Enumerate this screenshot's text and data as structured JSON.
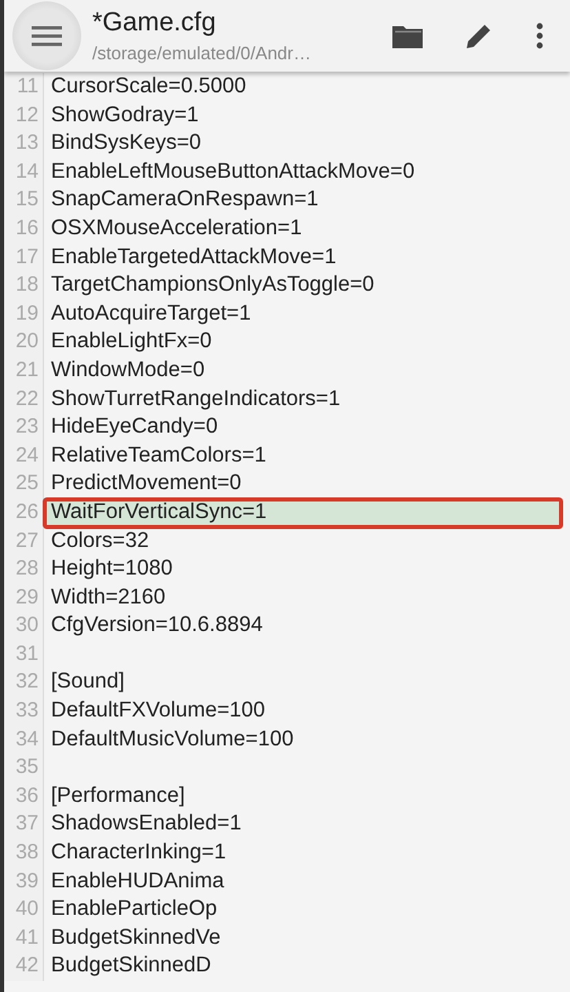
{
  "toolbar": {
    "title": "*Game.cfg",
    "path": "/storage/emulated/0/Andr…"
  },
  "lines": [
    {
      "number": "11",
      "text": "CursorScale=0.5000",
      "highlighted": false
    },
    {
      "number": "12",
      "text": "ShowGodray=1",
      "highlighted": false
    },
    {
      "number": "13",
      "text": "BindSysKeys=0",
      "highlighted": false
    },
    {
      "number": "14",
      "text": "EnableLeftMouseButtonAttackMove=0",
      "highlighted": false
    },
    {
      "number": "15",
      "text": "SnapCameraOnRespawn=1",
      "highlighted": false
    },
    {
      "number": "16",
      "text": "OSXMouseAcceleration=1",
      "highlighted": false
    },
    {
      "number": "17",
      "text": "EnableTargetedAttackMove=1",
      "highlighted": false
    },
    {
      "number": "18",
      "text": "TargetChampionsOnlyAsToggle=0",
      "highlighted": false
    },
    {
      "number": "19",
      "text": "AutoAcquireTarget=1",
      "highlighted": false
    },
    {
      "number": "20",
      "text": "EnableLightFx=0",
      "highlighted": false
    },
    {
      "number": "21",
      "text": "WindowMode=0",
      "highlighted": false
    },
    {
      "number": "22",
      "text": "ShowTurretRangeIndicators=1",
      "highlighted": false
    },
    {
      "number": "23",
      "text": "HideEyeCandy=0",
      "highlighted": false
    },
    {
      "number": "24",
      "text": "RelativeTeamColors=1",
      "highlighted": false
    },
    {
      "number": "25",
      "text": "PredictMovement=0",
      "highlighted": false
    },
    {
      "number": "26",
      "text": "WaitForVerticalSync=1",
      "highlighted": true
    },
    {
      "number": "27",
      "text": "Colors=32",
      "highlighted": false
    },
    {
      "number": "28",
      "text": "Height=1080",
      "highlighted": false
    },
    {
      "number": "29",
      "text": "Width=2160",
      "highlighted": false
    },
    {
      "number": "30",
      "text": "CfgVersion=10.6.8894",
      "highlighted": false
    },
    {
      "number": "31",
      "highlighted": false
    },
    {
      "number": "32",
      "text": "[Sound]",
      "highlighted": false
    },
    {
      "number": "33",
      "text": "DefaultFXVolume=100",
      "highlighted": false
    },
    {
      "number": "34",
      "text": "DefaultMusicVolume=100",
      "highlighted": false
    },
    {
      "number": "35",
      "highlighted": false
    },
    {
      "number": "36",
      "text": "[Performance]",
      "highlighted": false
    },
    {
      "number": "37",
      "text": "ShadowsEnabled=1",
      "highlighted": false
    },
    {
      "number": "38",
      "text": "CharacterInking=1",
      "highlighted": false
    },
    {
      "number": "39",
      "text": "EnableHUDAnima",
      "highlighted": false
    },
    {
      "number": "40",
      "text": "EnableParticleOp",
      "highlighted": false
    },
    {
      "number": "41",
      "text": "BudgetSkinnedVe",
      "highlighted": false
    },
    {
      "number": "42",
      "text": "BudgetSkinnedD",
      "highlighted": false
    }
  ]
}
